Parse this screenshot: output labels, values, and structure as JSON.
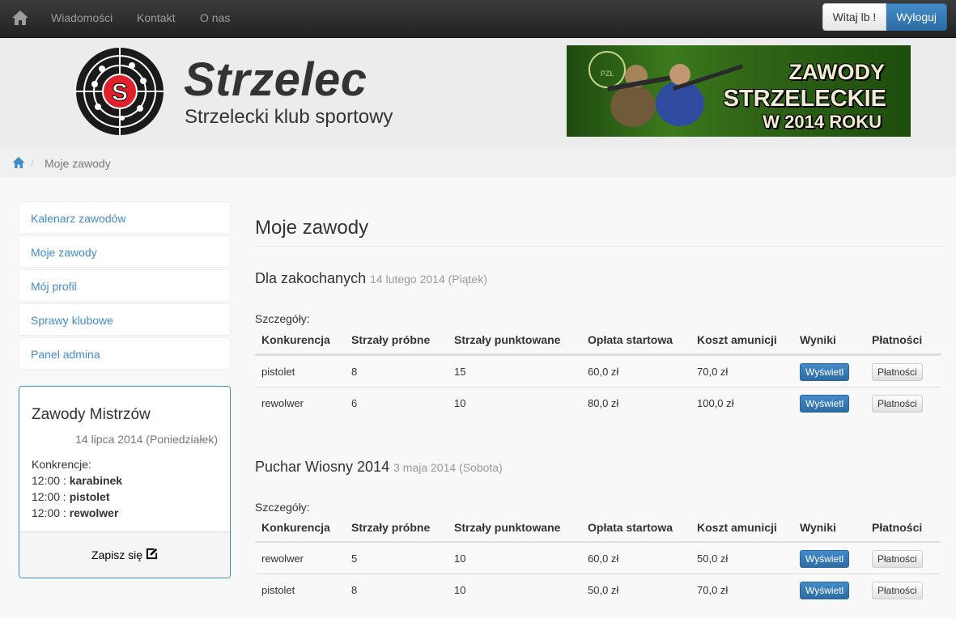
{
  "nav": {
    "home_icon": "home-icon",
    "links": [
      "Wiadomości",
      "Kontakt",
      "O nas"
    ],
    "welcome": "Witaj lb !",
    "logout": "Wyloguj"
  },
  "header": {
    "logo_letter": "S",
    "title": "Strzelec",
    "subtitle": "Strzelecki klub sportowy",
    "banner_lines": [
      "ZAWODY",
      "STRZELECKIE",
      "W 2014 ROKU"
    ],
    "banner_badge": "PZŁ"
  },
  "breadcrumb": {
    "separator": "/",
    "current": "Moje zawody"
  },
  "sidebar": {
    "items": [
      "Kalenarz zawodów",
      "Moje zawody",
      "Mój profil",
      "Sprawy klubowe",
      "Panel admina"
    ],
    "event": {
      "title": "Zawody Mistrzów",
      "date": "14 lipca 2014 (Poniedziałek)",
      "label": "Konkrencje:",
      "entries": [
        {
          "time": "12:00 :",
          "name": "karabinek"
        },
        {
          "time": "12:00 :",
          "name": "pistolet"
        },
        {
          "time": "12:00 :",
          "name": "rewolwer"
        }
      ],
      "signup": "Zapisz się",
      "signup_icon": "edit-icon"
    }
  },
  "main": {
    "title": "Moje zawody",
    "headers": [
      "Konkurencja",
      "Strzały próbne",
      "Strzały punktowane",
      "Opłata startowa",
      "Koszt amunicji",
      "Wyniki",
      "Płatności"
    ],
    "details_label": "Szczegóły:",
    "show_label": "Wyświetl",
    "pay_label": "Płatności",
    "competitions": [
      {
        "name": "Dla zakochanych",
        "date": "14 lutego 2014 (Piątek)",
        "rows": [
          [
            "pistolet",
            "8",
            "15",
            "60,0 zł",
            "70,0 zł"
          ],
          [
            "rewolwer",
            "6",
            "10",
            "80,0 zł",
            "100,0 zł"
          ]
        ]
      },
      {
        "name": "Puchar Wiosny 2014",
        "date": "3 maja 2014 (Sobota)",
        "rows": [
          [
            "rewolwer",
            "5",
            "10",
            "60,0 zł",
            "50,0 zł"
          ],
          [
            "pistolet",
            "8",
            "10",
            "50,0 zł",
            "70,0 zł"
          ]
        ]
      }
    ]
  }
}
